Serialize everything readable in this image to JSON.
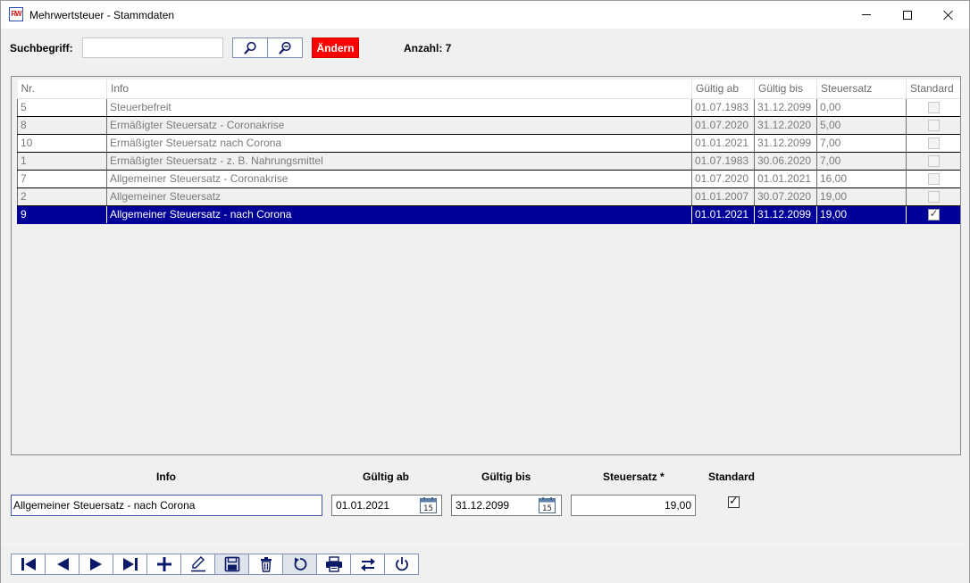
{
  "window": {
    "title": "Mehrwertsteuer - Stammdaten",
    "icon_text": "RW"
  },
  "search": {
    "label": "Suchbegriff:",
    "value": "",
    "placeholder": "",
    "change_button": "Ändern",
    "count_label": "Anzahl: 7"
  },
  "grid": {
    "columns": [
      "Nr.",
      "Info",
      "Gültig ab",
      "Gültig bis",
      "Steuersatz",
      "Standard"
    ],
    "rows": [
      {
        "nr": "5",
        "info": "Steuerbefreit",
        "from": "01.07.1983",
        "to": "31.12.2099",
        "rate": "0,00",
        "standard": false,
        "selected": false
      },
      {
        "nr": "8",
        "info": "Ermäßigter Steuersatz - Coronakrise",
        "from": "01.07.2020",
        "to": "31.12.2020",
        "rate": "5,00",
        "standard": false,
        "selected": false
      },
      {
        "nr": "10",
        "info": "Ermäßigter Steuersatz nach Corona",
        "from": "01.01.2021",
        "to": "31.12.2099",
        "rate": "7,00",
        "standard": false,
        "selected": false
      },
      {
        "nr": "1",
        "info": "Ermäßigter Steuersatz - z. B. Nahrungsmittel",
        "from": "01.07.1983",
        "to": "30.06.2020",
        "rate": "7,00",
        "standard": false,
        "selected": false
      },
      {
        "nr": "7",
        "info": "Allgemeiner Steuersatz - Coronakrise",
        "from": "01.07.2020",
        "to": "01.01.2021",
        "rate": "16,00",
        "standard": false,
        "selected": false
      },
      {
        "nr": "2",
        "info": "Allgemeiner Steuersatz",
        "from": "01.01.2007",
        "to": "30.07.2020",
        "rate": "19,00",
        "standard": false,
        "selected": false
      },
      {
        "nr": "9",
        "info": "Allgemeiner Steuersatz - nach Corona",
        "from": "01.01.2021",
        "to": "31.12.2099",
        "rate": "19,00",
        "standard": true,
        "selected": true
      }
    ]
  },
  "form": {
    "info_label": "Info",
    "from_label": "Gültig ab",
    "to_label": "Gültig bis",
    "rate_label": "Steuersatz *",
    "standard_label": "Standard",
    "info_value": "Allgemeiner Steuersatz - nach Corona",
    "from_value": "01.01.2021",
    "to_value": "31.12.2099",
    "rate_value": "19,00",
    "standard_checked": true,
    "calendar_day": "15"
  },
  "toolbar": {
    "buttons": [
      {
        "name": "first-record-button",
        "icon": "skip-first-icon"
      },
      {
        "name": "previous-record-button",
        "icon": "triangle-left-icon"
      },
      {
        "name": "next-record-button",
        "icon": "triangle-right-icon"
      },
      {
        "name": "last-record-button",
        "icon": "skip-last-icon"
      },
      {
        "name": "add-record-button",
        "icon": "plus-icon"
      },
      {
        "name": "edit-record-button",
        "icon": "pencil-icon"
      },
      {
        "name": "save-record-button",
        "icon": "floppy-icon"
      },
      {
        "name": "delete-record-button",
        "icon": "trash-icon"
      },
      {
        "name": "refresh-button",
        "icon": "refresh-icon"
      },
      {
        "name": "print-button",
        "icon": "printer-icon"
      },
      {
        "name": "swap-button",
        "icon": "swap-arrows-icon"
      },
      {
        "name": "power-button",
        "icon": "power-icon"
      }
    ]
  },
  "colors": {
    "accent_red": "#ff0000",
    "selection_blue": "#000099",
    "icon_navy": "#0b1a66"
  }
}
